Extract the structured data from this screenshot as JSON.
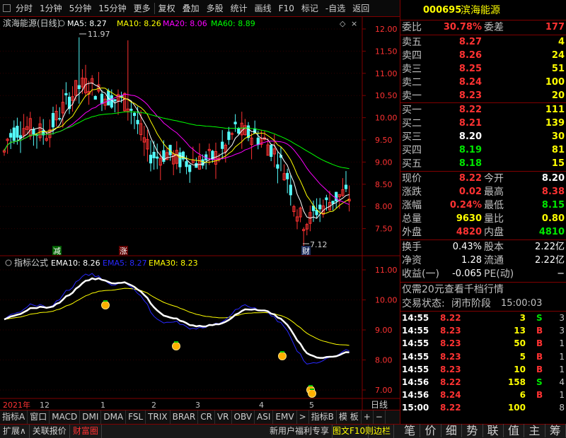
{
  "toolbar": {
    "items": [
      "分时",
      "1分钟",
      "5分钟",
      "15分钟",
      "更多",
      "复权",
      "叠加",
      "多股",
      "统计",
      "画线",
      "F10",
      "标记",
      "-自选",
      "返回"
    ]
  },
  "colors": {
    "up": "#ff3232",
    "down": "#54fcfc",
    "ma5": "#ffffff",
    "ma10": "#ffff00",
    "ma20": "#ff00ff",
    "ma60": "#00ff00",
    "ema5": "#2828ff",
    "ema10": "#ffffff",
    "ema30": "#ffff00"
  },
  "main": {
    "title": "滨海能源(日线)",
    "ma": [
      {
        "label": "MA5: 8.27"
      },
      {
        "label": "MA10: 8.26"
      },
      {
        "label": "MA20: 8.06"
      },
      {
        "label": "MA60: 8.89"
      }
    ],
    "yticks": [
      "12.00",
      "11.50",
      "11.00",
      "10.50",
      "10.00",
      "9.50",
      "9.00",
      "8.50",
      "8.00",
      "7.50"
    ],
    "high_label": "11.97",
    "low_label": "7.12",
    "tag_reduce": "减",
    "tag_rise": "涨",
    "tag_fin": "财"
  },
  "sub": {
    "title": "指标公式",
    "ema": [
      {
        "label": "EMA10: 8.26"
      },
      {
        "label": "EMA5: 8.27"
      },
      {
        "label": "EMA30: 8.23"
      }
    ],
    "yticks": [
      "11.00",
      "10.00",
      "9.00",
      "8.00",
      "7.00"
    ]
  },
  "xaxis": {
    "year": "2021年",
    "months": [
      "12",
      "1",
      "2",
      "3",
      "4",
      "5"
    ],
    "period": "日线"
  },
  "tabs": [
    "指标A",
    "窗口",
    "MACD",
    "DMI",
    "DMA",
    "FSL",
    "TRIX",
    "BRAR",
    "CR",
    "VR",
    "OBV",
    "ASI",
    "EMV",
    ">",
    "指标B",
    "模 板",
    "+",
    "−"
  ],
  "quote": {
    "code": "000695",
    "name": "滨海能源",
    "webi_label": "委比",
    "webi": "30.78%",
    "wecha_label": "委差",
    "wecha": "177",
    "sell": [
      {
        "l": "卖五",
        "p": "8.27",
        "v": "4"
      },
      {
        "l": "卖四",
        "p": "8.26",
        "v": "24"
      },
      {
        "l": "卖三",
        "p": "8.25",
        "v": "51"
      },
      {
        "l": "卖二",
        "p": "8.24",
        "v": "100"
      },
      {
        "l": "卖一",
        "p": "8.23",
        "v": "20"
      }
    ],
    "buy": [
      {
        "l": "买一",
        "p": "8.22",
        "v": "111"
      },
      {
        "l": "买二",
        "p": "8.21",
        "v": "139"
      },
      {
        "l": "买三",
        "p": "8.20",
        "v": "30"
      },
      {
        "l": "买四",
        "p": "8.19",
        "v": "81"
      },
      {
        "l": "买五",
        "p": "8.18",
        "v": "15"
      }
    ],
    "stats": [
      {
        "a": "现价",
        "b": "8.22",
        "c": "今开",
        "d": "8.20"
      },
      {
        "a": "涨跌",
        "b": "0.02",
        "c": "最高",
        "d": "8.38"
      },
      {
        "a": "涨幅",
        "b": "0.24%",
        "c": "最低",
        "d": "8.15"
      },
      {
        "a": "总量",
        "b": "9630",
        "c": "量比",
        "d": "0.80"
      },
      {
        "a": "外盘",
        "b": "4820",
        "c": "内盘",
        "d": "4810"
      }
    ],
    "stats2": [
      {
        "a": "换手",
        "b": "0.43%",
        "c": "股本",
        "d": "2.22亿"
      },
      {
        "a": "净资",
        "b": "1.28",
        "c": "流通",
        "d": "2.22亿"
      },
      {
        "a": "收益(一)",
        "b": "-0.065",
        "c": "PE(动)",
        "d": "−"
      }
    ],
    "promo": "仅需20元查看千档行情",
    "status_label": "交易状态:",
    "status": "闭市阶段",
    "status_time": "15:00:03",
    "ticks": [
      {
        "t": "14:55",
        "p": "8.22",
        "v": "3",
        "s": "S",
        "n": "3"
      },
      {
        "t": "14:55",
        "p": "8.23",
        "v": "13",
        "s": "B",
        "n": "3"
      },
      {
        "t": "14:55",
        "p": "8.23",
        "v": "50",
        "s": "B",
        "n": "1"
      },
      {
        "t": "14:55",
        "p": "8.23",
        "v": "5",
        "s": "B",
        "n": "1"
      },
      {
        "t": "14:55",
        "p": "8.23",
        "v": "10",
        "s": "B",
        "n": "1"
      },
      {
        "t": "14:56",
        "p": "8.22",
        "v": "158",
        "s": "S",
        "n": "4"
      },
      {
        "t": "14:56",
        "p": "8.24",
        "v": "6",
        "s": "B",
        "n": "1"
      },
      {
        "t": "15:00",
        "p": "8.22",
        "v": "100",
        "s": "",
        "n": "8"
      }
    ]
  },
  "bottom": {
    "left": [
      "扩展∧",
      "关联报价",
      "财富圈"
    ],
    "right": [
      "新用户福利专享",
      "图文F10",
      "则边栏"
    ],
    "rtabs": [
      "笔",
      "价",
      "细",
      "势",
      "联",
      "值",
      "主",
      "筹"
    ]
  }
}
